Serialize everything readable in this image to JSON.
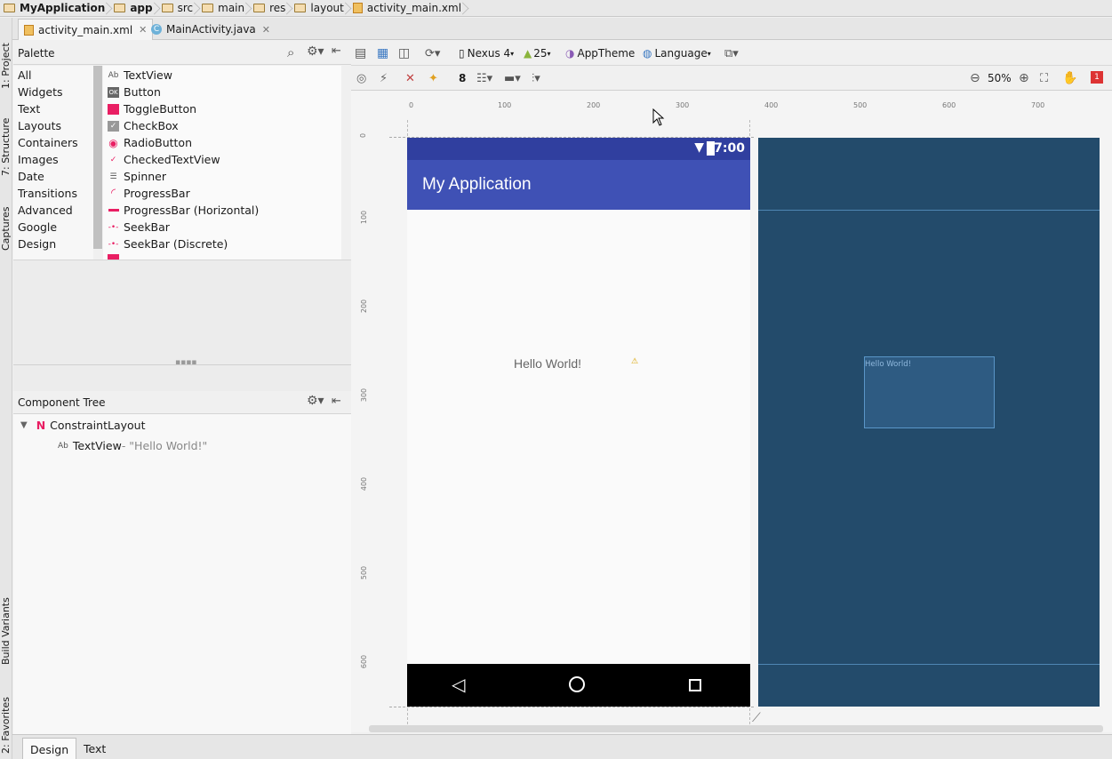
{
  "breadcrumb": [
    "MyApplication",
    "app",
    "src",
    "main",
    "res",
    "layout",
    "activity_main.xml"
  ],
  "editor_tabs": [
    {
      "label": "activity_main.xml",
      "active": true
    },
    {
      "label": "MainActivity.java",
      "active": false
    }
  ],
  "left_strip": [
    "1: Project",
    "7: Structure",
    "Captures",
    "Build Variants",
    "2: Favorites"
  ],
  "palette": {
    "title": "Palette",
    "categories": [
      "All",
      "Widgets",
      "Text",
      "Layouts",
      "Containers",
      "Images",
      "Date",
      "Transitions",
      "Advanced",
      "Google",
      "Design"
    ],
    "items": [
      {
        "icon": "textview-icon",
        "label": "TextView"
      },
      {
        "icon": "button-icon",
        "label": "Button"
      },
      {
        "icon": "togglebutton-icon",
        "label": "ToggleButton"
      },
      {
        "icon": "checkbox-icon",
        "label": "CheckBox"
      },
      {
        "icon": "radiobutton-icon",
        "label": "RadioButton"
      },
      {
        "icon": "checkedtextview-icon",
        "label": "CheckedTextView"
      },
      {
        "icon": "spinner-icon",
        "label": "Spinner"
      },
      {
        "icon": "progressbar-icon",
        "label": "ProgressBar"
      },
      {
        "icon": "progressbar-horizontal-icon",
        "label": "ProgressBar (Horizontal)"
      },
      {
        "icon": "seekbar-icon",
        "label": "SeekBar"
      },
      {
        "icon": "seekbar-discrete-icon",
        "label": "SeekBar (Discrete)"
      }
    ]
  },
  "component_tree": {
    "title": "Component Tree",
    "root": "ConstraintLayout",
    "child_prefix": "Ab",
    "child": "TextView",
    "child_hint": " - \"Hello World!\""
  },
  "toolbar": {
    "device": "Nexus 4",
    "api": "25",
    "theme": "AppTheme",
    "language": "Language",
    "margin": "8",
    "zoom": "50%",
    "error_count": "1"
  },
  "rulers": {
    "h": [
      "0",
      "100",
      "200",
      "300",
      "400",
      "500",
      "600",
      "700"
    ],
    "v": [
      "0",
      "100",
      "200",
      "300",
      "400",
      "500",
      "600"
    ]
  },
  "device": {
    "time": "7:00",
    "app_title": "My Application",
    "hello_text": "Hello World!"
  },
  "blueprint": {
    "label": "Hello World!"
  },
  "colors": {
    "status_bar": "#303f9f",
    "app_bar": "#3f51b5",
    "blueprint_bg": "#234b6b",
    "accent": "#e91e63"
  },
  "bottom_tabs": [
    {
      "label": "Design",
      "active": true
    },
    {
      "label": "Text",
      "active": false
    }
  ]
}
